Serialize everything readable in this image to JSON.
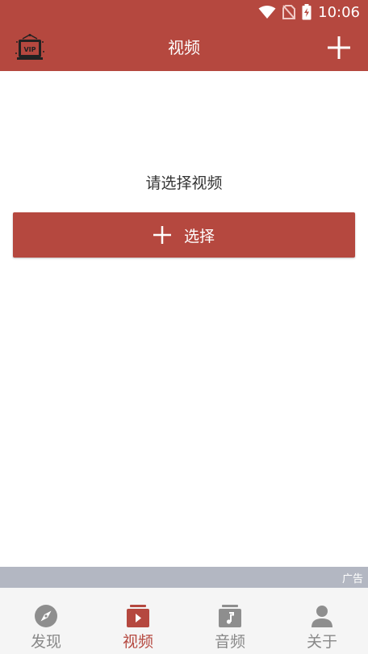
{
  "status_bar": {
    "time": "10:06"
  },
  "app_bar": {
    "title": "视频"
  },
  "main": {
    "prompt": "请选择视频",
    "select_label": "选择"
  },
  "ad": {
    "label": "广告"
  },
  "bottom_nav": {
    "items": [
      {
        "label": "发现",
        "icon": "compass-icon",
        "active": false
      },
      {
        "label": "视频",
        "icon": "video-icon",
        "active": true
      },
      {
        "label": "音频",
        "icon": "music-icon",
        "active": false
      },
      {
        "label": "关于",
        "icon": "person-icon",
        "active": false
      }
    ]
  },
  "colors": {
    "accent": "#b5483f",
    "inactive": "#888888",
    "ad_bar": "#b3b7c2"
  }
}
